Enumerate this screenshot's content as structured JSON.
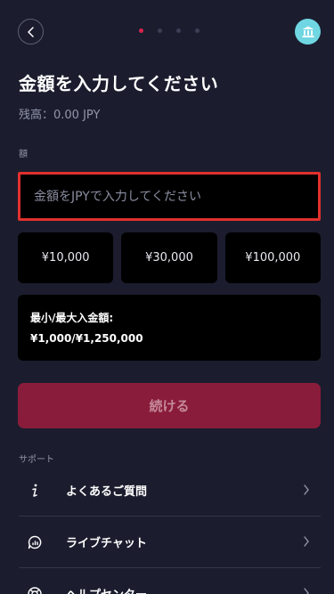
{
  "header": {
    "back": "back",
    "step_dots": [
      true,
      false,
      false,
      false
    ],
    "bank_icon": "bank-icon"
  },
  "title": "金額を入力してください",
  "balance": "残高：0.00 JPY",
  "amount": {
    "label": "額",
    "placeholder": "金額をJPYで入力してください",
    "value": ""
  },
  "presets": [
    "¥10,000",
    "¥30,000",
    "¥100,000"
  ],
  "limits": {
    "label": "最小/最大入金額:",
    "value": "¥1,000/¥1,250,000"
  },
  "continue_label": "続ける",
  "support": {
    "label": "サポート",
    "items": [
      {
        "label": "よくあるご質問",
        "icon": "info-icon"
      },
      {
        "label": "ライブチャット",
        "icon": "chat-icon"
      },
      {
        "label": "ヘルプセンター",
        "icon": "help-icon"
      }
    ]
  },
  "colors": {
    "background": "#1b1d2e",
    "accent": "#d7244e",
    "button_disabled": "#8a1c3b",
    "highlight_border": "#e0302d",
    "bank_icon_bg": "#6fd6e2"
  }
}
